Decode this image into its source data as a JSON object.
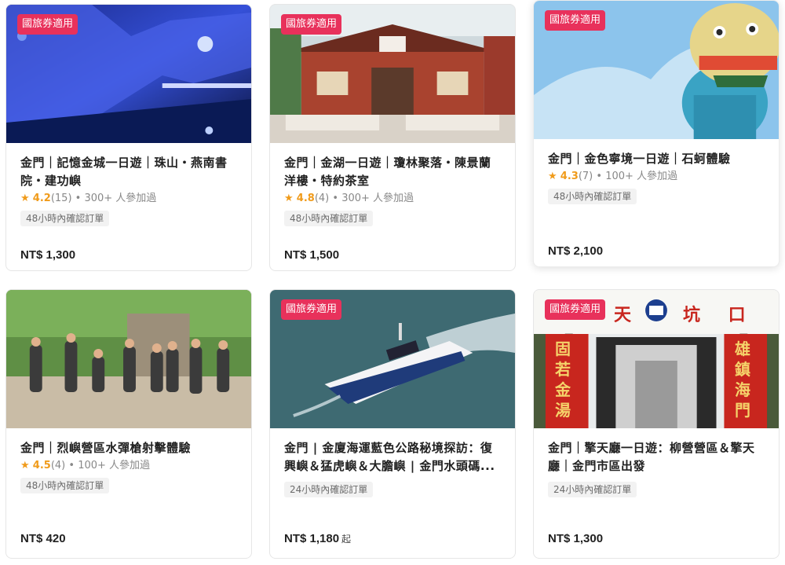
{
  "cards": [
    {
      "badge": "國旅券適用",
      "title": "金門｜記憶金城一日遊｜珠山・燕南書院・建功嶼",
      "rating": "4.2",
      "reviews": "(15)",
      "participants": "• 300+ 人參加過",
      "confirm": "48小時內確認訂單",
      "price": "NT$ 1,300",
      "price_suffix": "",
      "image": "blue-cave-icon"
    },
    {
      "badge": "國旅券適用",
      "title": "金門｜金湖一日遊｜瓊林聚落・陳景蘭洋樓・特約茶室",
      "rating": "4.8",
      "reviews": "(4)",
      "participants": "• 300+ 人參加過",
      "confirm": "48小時內確認訂單",
      "price": "NT$ 1,500",
      "price_suffix": "",
      "image": "traditional-house-icon"
    },
    {
      "badge": "國旅券適用",
      "title": "金門｜金色寧境一日遊｜石蚵體驗",
      "rating": "4.3",
      "reviews": "(7)",
      "participants": "• 100+ 人參加過",
      "confirm": "48小時內確認訂單",
      "price": "NT$ 2,100",
      "price_suffix": "",
      "image": "wind-lion-statue-icon"
    },
    {
      "badge": "",
      "title": "金門｜烈嶼營區水彈槍射擊體驗",
      "rating": "4.5",
      "reviews": "(4)",
      "participants": "• 100+ 人參加過",
      "confirm": "48小時內確認訂單",
      "price": "NT$ 420",
      "price_suffix": "",
      "image": "group-photo-icon"
    },
    {
      "badge": "國旅券適用",
      "title": "金門 | 金廈海運藍色公路秘境探訪：復興嶼＆猛虎嶼＆大膽嶼 | 金門水頭碼...",
      "rating": "",
      "reviews": "",
      "participants": "",
      "confirm": "24小時內確認訂單",
      "price": "NT$ 1,180",
      "price_suffix": "起",
      "image": "ferry-boat-icon"
    },
    {
      "badge": "國旅券適用",
      "title": "金門｜擎天廳一日遊：柳營營區＆擎天廳｜金門市區出發",
      "rating": "",
      "reviews": "",
      "participants": "",
      "confirm": "24小時內確認訂單",
      "price": "NT$ 1,300",
      "price_suffix": "",
      "image": "tunnel-entrance-icon"
    }
  ],
  "signage": {
    "tunnel_top_left": "天",
    "tunnel_top_right": "坑 口",
    "tunnel_left_banner": "固若金湯",
    "tunnel_right_banner": "雄鎮海門"
  },
  "colors": {
    "badge": "#e8315b",
    "star": "#f09b1b"
  }
}
